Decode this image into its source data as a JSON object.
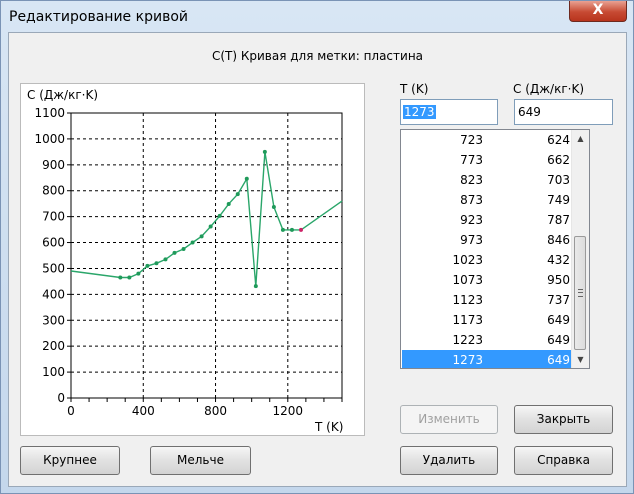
{
  "window": {
    "title": "Редактирование кривой",
    "close_label": "X",
    "heading": "C(T) Кривая для метки: пластина"
  },
  "fields": {
    "t_label": "T (K)",
    "c_label": "C (Дж/кг·K)",
    "t_value": "1273",
    "c_value": "649"
  },
  "table": {
    "rows": [
      {
        "t": "723",
        "c": "624"
      },
      {
        "t": "773",
        "c": "662"
      },
      {
        "t": "823",
        "c": "703"
      },
      {
        "t": "873",
        "c": "749"
      },
      {
        "t": "923",
        "c": "787"
      },
      {
        "t": "973",
        "c": "846"
      },
      {
        "t": "1023",
        "c": "432"
      },
      {
        "t": "1073",
        "c": "950"
      },
      {
        "t": "1123",
        "c": "737"
      },
      {
        "t": "1173",
        "c": "649"
      },
      {
        "t": "1223",
        "c": "649"
      },
      {
        "t": "1273",
        "c": "649"
      }
    ],
    "selected_index": 11
  },
  "buttons": {
    "modify": "Изменить",
    "close": "Закрыть",
    "bigger": "Крупнее",
    "smaller": "Мельче",
    "delete": "Удалить",
    "help": "Справка"
  },
  "colors": {
    "curve": "#2aa66a",
    "point": "#1f9a5a",
    "selected_point": "#cc2266",
    "selection": "#3399ff"
  },
  "chart_data": {
    "type": "line",
    "ylabel": "C (Дж/кг·K)",
    "xlabel": "T (K)",
    "xlim": [
      0,
      1500
    ],
    "ylim": [
      0,
      1100
    ],
    "x_ticks": [
      0,
      400,
      800,
      1200
    ],
    "y_ticks": [
      0,
      100,
      200,
      300,
      400,
      500,
      600,
      700,
      800,
      900,
      1000,
      1100
    ],
    "grid": true,
    "series": [
      {
        "points": [
          [
            0,
            490
          ],
          [
            273,
            465
          ],
          [
            323,
            465
          ],
          [
            373,
            480
          ],
          [
            423,
            510
          ],
          [
            473,
            520
          ],
          [
            523,
            535
          ],
          [
            573,
            560
          ],
          [
            623,
            575
          ],
          [
            673,
            600
          ],
          [
            723,
            624
          ],
          [
            773,
            662
          ],
          [
            823,
            703
          ],
          [
            873,
            749
          ],
          [
            923,
            787
          ],
          [
            973,
            846
          ],
          [
            1023,
            432
          ],
          [
            1073,
            950
          ],
          [
            1123,
            737
          ],
          [
            1173,
            649
          ],
          [
            1223,
            649
          ],
          [
            1273,
            649
          ],
          [
            1500,
            760
          ]
        ],
        "markers_from": 1,
        "markers_to": 21
      }
    ],
    "selected_point": [
      1273,
      649
    ]
  }
}
